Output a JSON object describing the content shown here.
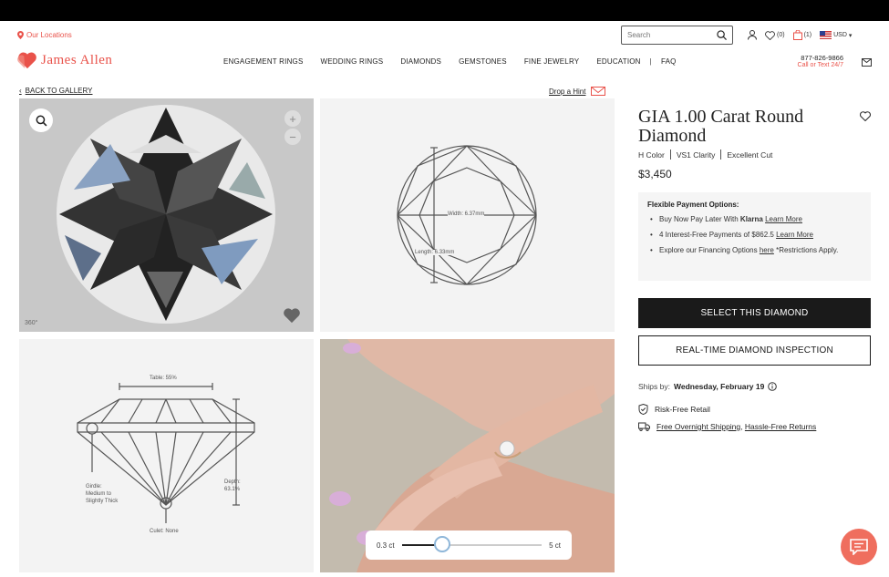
{
  "header": {
    "locations_label": "Our Locations",
    "search_placeholder": "Search",
    "wishlist_count": "(0)",
    "cart_count": "(1)",
    "currency": "USD",
    "brand_name": "James Allen",
    "nav": [
      "ENGAGEMENT RINGS",
      "WEDDING RINGS",
      "DIAMONDS",
      "GEMSTONES",
      "FINE JEWELRY",
      "EDUCATION",
      "FAQ"
    ],
    "nav_separator": "|",
    "phone": "877-826-9866",
    "phone_cta": "Call or Text 24/7"
  },
  "subbar": {
    "back_label": "BACK TO GALLERY",
    "hint_label": "Drop a Hint"
  },
  "gallery": {
    "badge_360": "360°",
    "top_view": {
      "width_label": "Width: 6.37mm",
      "length_label": "Length: 6.33mm"
    },
    "profile_view": {
      "table_label": "Table: 55%",
      "girdle_label": [
        "Girdle:",
        "Medium to",
        "Slightly Thick"
      ],
      "depth_label": [
        "Depth:",
        "63.1%"
      ],
      "culet_label": "Culet: None"
    },
    "carat_slider": {
      "min_label": "0.3 ct",
      "max_label": "5 ct",
      "position": 0.29
    }
  },
  "product": {
    "title": "GIA 1.00 Carat Round Diamond",
    "specs": [
      "H Color",
      "VS1 Clarity",
      "Excellent Cut"
    ],
    "price": "$3,450",
    "payment": {
      "heading": "Flexible Payment Options:",
      "line1_pre": "Buy Now Pay Later With ",
      "line1_bold": "Klarna",
      "line1_link": "Learn More",
      "line2_pre": "4 Interest-Free Payments of $862.5 ",
      "line2_link": "Learn More",
      "line3_pre": "Explore our Financing Options ",
      "line3_link": "here",
      "line3_post": " *Restrictions Apply."
    },
    "select_button": "SELECT THIS DIAMOND",
    "inspect_button": "REAL-TIME DIAMOND INSPECTION",
    "ships_label": "Ships by:",
    "ships_date": "Wednesday, February 19",
    "risk_free": "Risk-Free Retail",
    "shipping_link": "Free Overnight Shipping",
    "returns_link": "Hassle-Free Returns",
    "shipping_sep": ", "
  },
  "colors": {
    "brand": "#e9524a",
    "dark_button": "#1a1a1a",
    "chat": "#ef6e5e"
  }
}
